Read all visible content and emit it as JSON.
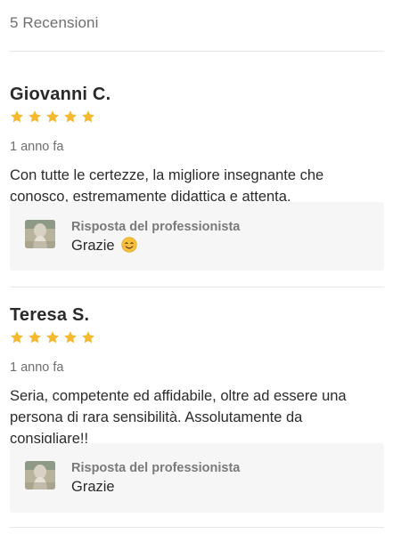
{
  "header": {
    "review_count_label": "5 Recensioni"
  },
  "reviews": [
    {
      "name": "Giovanni C.",
      "rating": 5,
      "date": "1 anno fa",
      "text": "Con tutte le certezze, la migliore insegnante che conosco, estremamente didattica e attenta.",
      "reply": {
        "title": "Risposta del professionista",
        "text": "Grazie",
        "emoji": "smiling-face-emoji"
      }
    },
    {
      "name": "Teresa S.",
      "rating": 5,
      "date": "1 anno fa",
      "text": "Seria, competente ed affidabile, oltre ad essere una persona di rara sensibilità. Assolutamente da consigliare!!",
      "reply": {
        "title": "Risposta del professionista",
        "text": "Grazie"
      }
    }
  ],
  "colors": {
    "star": "#f5b82e",
    "muted_text": "#6f6f6f",
    "reply_background": "#f6f6f6",
    "divider": "#e8e8e8"
  }
}
